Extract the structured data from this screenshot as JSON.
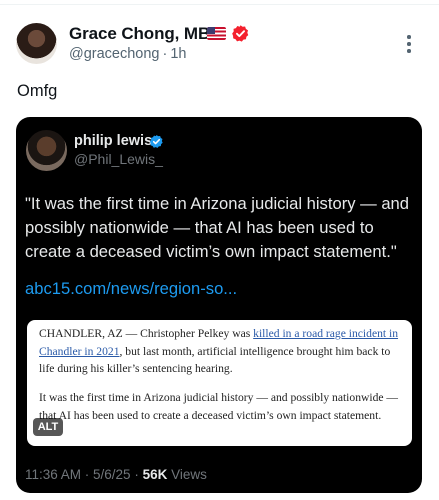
{
  "post": {
    "author_name": "Grace Chong, MBI",
    "flag_icon": "us-flag-icon",
    "verified_badge_color": "#f4212e",
    "handle": "@gracechong",
    "separator": "·",
    "time": "1h",
    "text": "Omfg"
  },
  "quoted": {
    "author_name": "philip lewis",
    "verified_badge_color": "#1d9bf0",
    "handle": "@Phil_Lewis_",
    "text": "\"It was the first time in Arizona judicial history — and possibly nationwide — that AI has been used to create a deceased victim’s own impact statement.\"",
    "link": "abc15.com/news/region-so...",
    "image": {
      "p1_prefix": "CHANDLER, AZ — Christopher Pelkey was ",
      "p1_link": "killed in a road rage incident in Chandler in 2021",
      "p1_suffix": ", but last month, artificial intelligence brought him back to life during his killer’s sentencing hearing.",
      "p2": "It was the first time in Arizona judicial history — and possibly nationwide — that AI has been used to create a deceased victim’s own impact statement.",
      "alt_label": "ALT"
    },
    "timestamp": "11:36 AM · 5/6/25 · ",
    "views_count": "56K",
    "views_label": " Views"
  },
  "colors": {
    "background": "#ffffff",
    "quote_background": "#000000",
    "link": "#1d9bf0",
    "secondary_text": "#536471"
  }
}
